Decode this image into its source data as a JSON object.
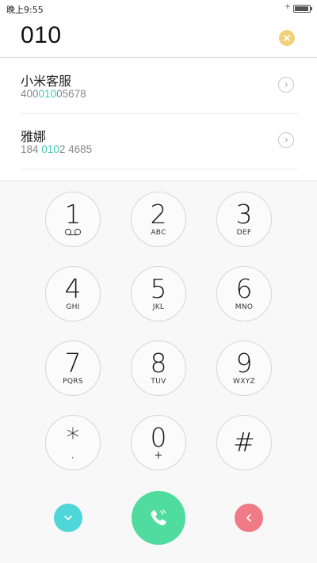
{
  "status_bar": {
    "time": "晚上9:55"
  },
  "dial_input": {
    "value": "010"
  },
  "results": [
    {
      "name": "小米客服",
      "number_prefix": "400",
      "number_match": "010",
      "number_suffix": "05678"
    },
    {
      "name": "雅娜",
      "number_prefix": "184 ",
      "number_match": "010",
      "number_suffix": "2 4685"
    }
  ],
  "keypad": {
    "k1": {
      "digit": "1",
      "letters": ""
    },
    "k2": {
      "digit": "2",
      "letters": "ABC"
    },
    "k3": {
      "digit": "3",
      "letters": "DEF"
    },
    "k4": {
      "digit": "4",
      "letters": "GHI"
    },
    "k5": {
      "digit": "5",
      "letters": "JKL"
    },
    "k6": {
      "digit": "6",
      "letters": "MNO"
    },
    "k7": {
      "digit": "7",
      "letters": "PQRS"
    },
    "k8": {
      "digit": "8",
      "letters": "TUV"
    },
    "k9": {
      "digit": "9",
      "letters": "WXYZ"
    },
    "kstar": {
      "digit": "*",
      "letters": ","
    },
    "k0": {
      "digit": "0",
      "letters": "+"
    },
    "khash": {
      "digit": "#",
      "letters": ""
    }
  },
  "icons": {
    "clear": "close-icon",
    "detail": "chevron-right-icon",
    "voicemail": "voicemail-icon",
    "hide_keypad": "chevron-down-icon",
    "call": "phone-icon",
    "delete": "backspace-icon"
  },
  "colors": {
    "highlight": "#3ec9b6",
    "clear_button": "#f1d27a",
    "hide_keypad_button": "#4fd6d9",
    "call_button": "#4fdc9e",
    "delete_button": "#f07a86"
  }
}
